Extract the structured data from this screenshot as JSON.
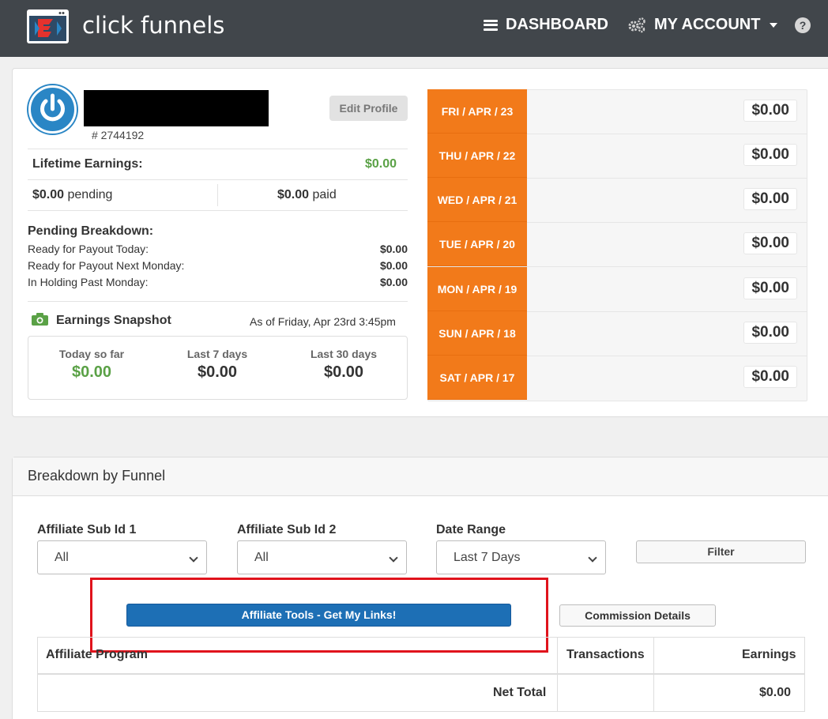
{
  "nav": {
    "brand": "click funnels",
    "dashboard": "DASHBOARD",
    "account": "MY ACCOUNT",
    "help": "?"
  },
  "profile": {
    "user_id": "# 2744192",
    "edit_label": "Edit Profile"
  },
  "earnings": {
    "lifetime_label": "Lifetime Earnings:",
    "lifetime_value": "$0.00",
    "pending_value": "$0.00",
    "pending_label": "pending",
    "paid_value": "$0.00",
    "paid_label": "paid"
  },
  "pending_breakdown": {
    "title": "Pending Breakdown:",
    "rows": [
      {
        "label": "Ready for Payout Today:",
        "value": "$0.00"
      },
      {
        "label": "Ready for Payout Next Monday:",
        "value": "$0.00"
      },
      {
        "label": "In Holding Past Monday:",
        "value": "$0.00"
      }
    ]
  },
  "snapshot": {
    "title": "Earnings Snapshot",
    "as_of": "As of Friday, Apr 23rd 3:45pm",
    "cols": [
      {
        "label": "Today so far",
        "value": "$0.00"
      },
      {
        "label": "Last 7 days",
        "value": "$0.00"
      },
      {
        "label": "Last 30 days",
        "value": "$0.00"
      }
    ]
  },
  "days": [
    {
      "label": "FRI / APR / 23",
      "value": "$0.00"
    },
    {
      "label": "THU / APR / 22",
      "value": "$0.00"
    },
    {
      "label": "WED / APR / 21",
      "value": "$0.00"
    },
    {
      "label": "TUE / APR / 20",
      "value": "$0.00"
    },
    {
      "label": "MON / APR / 19",
      "value": "$0.00"
    },
    {
      "label": "SUN / APR / 18",
      "value": "$0.00"
    },
    {
      "label": "SAT / APR / 17",
      "value": "$0.00"
    }
  ],
  "breakdown": {
    "title": "Breakdown by Funnel",
    "sub1_label": "Affiliate Sub Id 1",
    "sub1_value": "All",
    "sub2_label": "Affiliate Sub Id 2",
    "sub2_value": "All",
    "range_label": "Date Range",
    "range_value": "Last 7 Days",
    "filter": "Filter",
    "aff_tools": "Affiliate Tools - Get My Links!",
    "commission": "Commission Details"
  },
  "table": {
    "col_program": "Affiliate Program",
    "col_transactions": "Transactions",
    "col_earnings": "Earnings",
    "net_total_label": "Net Total",
    "net_total_value": "$0.00"
  },
  "colors": {
    "nav_bg": "#41464b",
    "accent_green": "#5aa146",
    "day_orange": "#f27a1a",
    "primary_blue": "#1d6fb5",
    "highlight_red": "#e0131c"
  }
}
